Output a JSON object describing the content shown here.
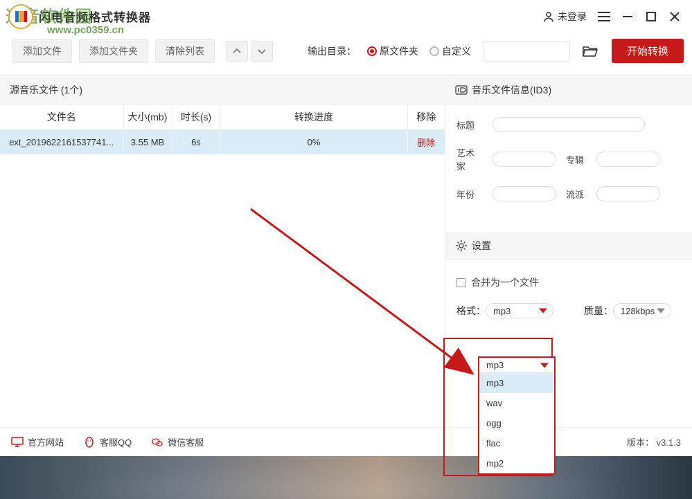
{
  "watermark": {
    "line1": "通音软件园",
    "line2": "www.pc0359.cn"
  },
  "titlebar": {
    "app_name": "闪电音频格式转换器",
    "login_text": "未登录"
  },
  "toolbar": {
    "add_file": "添加文件",
    "add_folder": "添加文件夹",
    "clear_list": "清除列表",
    "output_label": "输出目录：",
    "radio_original": "原文件夹",
    "radio_custom": "自定义",
    "start_convert": "开始转换"
  },
  "filelist": {
    "header": "源音乐文件 (1个)",
    "columns": {
      "name": "文件名",
      "size": "大小(mb)",
      "duration": "时长(s)",
      "progress": "转换进度",
      "remove": "移除"
    },
    "rows": [
      {
        "name": "ext_201962216153774‪1...",
        "size": "3.55 MB",
        "duration": "6s",
        "progress": "0%",
        "remove": "删除"
      }
    ]
  },
  "id3": {
    "header": "音乐文件信息(ID3)",
    "title_label": "标题",
    "artist_label": "艺术家",
    "album_label": "专辑",
    "year_label": "年份",
    "genre_label": "流派"
  },
  "settings": {
    "header": "设置",
    "merge_label": "合并为一个文件",
    "format_label": "格式：",
    "format_value": "mp3",
    "format_options": [
      "mp3",
      "wav",
      "ogg",
      "flac",
      "mp2"
    ],
    "quality_label": "质量：",
    "quality_value": "128kbps"
  },
  "footer": {
    "site": "官方网站",
    "qq": "客服QQ",
    "wechat": "微信客服",
    "version": "版本： v3.1.3"
  }
}
